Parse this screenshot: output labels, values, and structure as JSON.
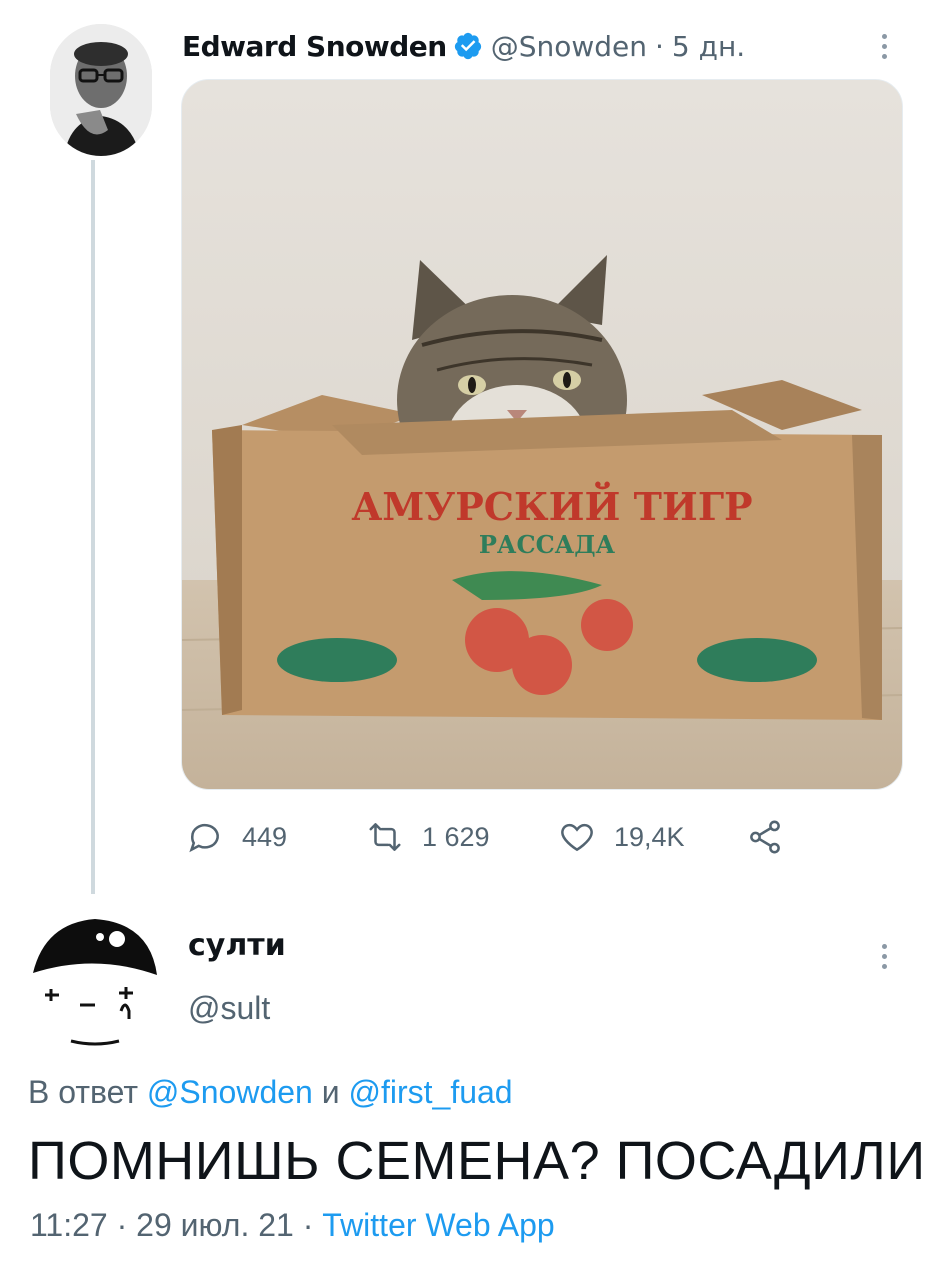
{
  "tweet": {
    "author_name": "Edward Snowden",
    "handle": "@Snowden",
    "separator": "·",
    "time": "5 дн.",
    "media": {
      "box_title": "АМУРСКИЙ ТИГР",
      "box_subtitle": "РАССАДА"
    },
    "actions": {
      "replies": "449",
      "retweets": "1 629",
      "likes": "19,4K"
    }
  },
  "reply": {
    "author_name": "султи",
    "handle": "@sult",
    "reply_prefix": "В ответ",
    "mention_1": "@Snowden",
    "conjunction": "и",
    "mention_2": "@first_fuad",
    "text": "ПОМНИШЬ СЕМЕНА? ПОСАДИЛИ",
    "time": "11:27",
    "date": "29 июл. 21",
    "separator": "·",
    "source": "Twitter Web App"
  },
  "colors": {
    "link_blue": "#1d9bf0",
    "secondary_text": "#536471",
    "primary_text": "#0f1419",
    "thread_line": "#cfd9de",
    "box_text_red": "#c0392b",
    "box_text_green": "#2f7d5b"
  },
  "icons": [
    "verified-badge-icon",
    "more-icon",
    "reply-icon",
    "retweet-icon",
    "like-icon",
    "share-icon"
  ]
}
